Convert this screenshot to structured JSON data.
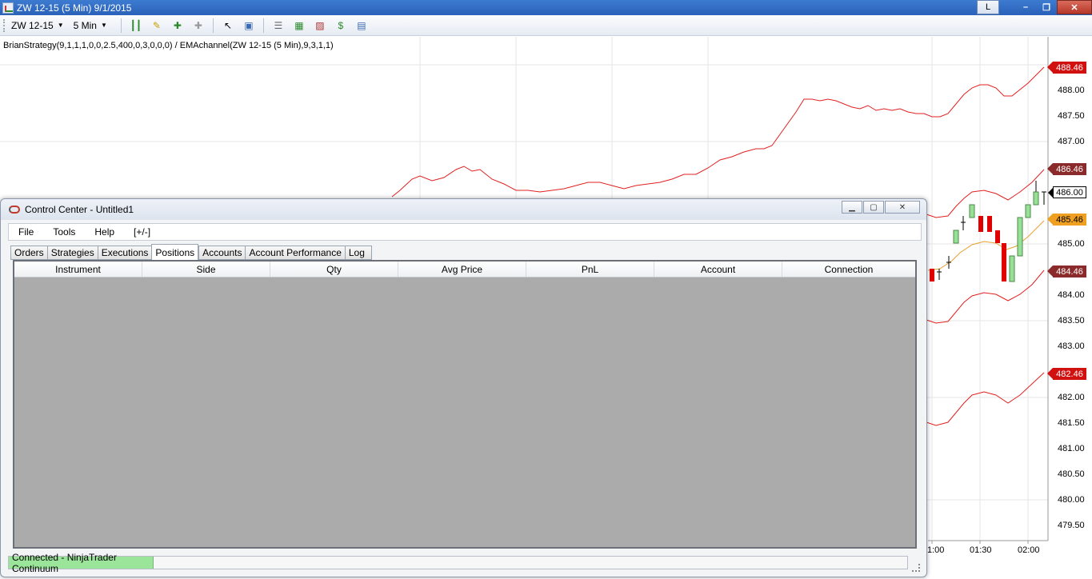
{
  "window": {
    "title": "ZW 12-15 (5 Min)  9/1/2015",
    "layout_button": "L",
    "min_icon": "minimize-icon",
    "max_icon": "maximize-icon",
    "close_icon": "close-icon"
  },
  "toolbar": {
    "instrument": "ZW 12-15",
    "interval": "5 Min"
  },
  "chart": {
    "indicator_label": "BrianStrategy(9,1,1,1,0,0,2.5,400,0,3,0,0,0) / EMAchannel(ZW 12-15 (5 Min),9,3,1,1)",
    "price_axis": [
      "488.00",
      "487.50",
      "487.00",
      "485.00",
      "484.00",
      "483.50",
      "483.00",
      "482.00",
      "481.50",
      "481.00",
      "480.50",
      "480.00",
      "479.50"
    ],
    "price_tags": [
      {
        "label": "488.46",
        "color": "#d11010"
      },
      {
        "label": "486.46",
        "color": "#8b2a2a"
      },
      {
        "label": "486.00",
        "color": "#111111"
      },
      {
        "label": "485.46",
        "color": "#f0a020"
      },
      {
        "label": "484.46",
        "color": "#8b2a2a"
      },
      {
        "label": "482.46",
        "color": "#d11010"
      }
    ],
    "time_axis": [
      "1:00",
      "01:30",
      "02:00"
    ],
    "colors": {
      "channel": "#e22020",
      "ema": "#e8a030",
      "up": "#98e098",
      "down": "#e00000",
      "grid": "#e8e8e8"
    }
  },
  "control_center": {
    "title": "Control Center - Untitled1",
    "menu": [
      "File",
      "Tools",
      "Help",
      "[+/-]"
    ],
    "tabs": [
      "Orders",
      "Strategies",
      "Executions",
      "Positions",
      "Accounts",
      "Account Performance",
      "Log"
    ],
    "active_tab": "Positions",
    "columns": [
      "Instrument",
      "Side",
      "Qty",
      "Avg Price",
      "PnL",
      "Account",
      "Connection"
    ],
    "status": "Connected - NinjaTrader Continuum"
  }
}
